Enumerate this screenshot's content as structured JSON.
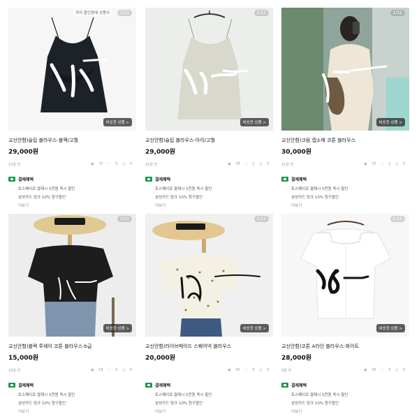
{
  "cards": [
    {
      "page": "1/12",
      "sponsor": "최저 할인판매 상품사",
      "similar": "비슷한 상품 >",
      "handwriting": "18,-",
      "title": "교신안함)슬립 블라우스-블랙/고퀄",
      "price": "29,000원",
      "ago": "15일 전",
      "stats": {
        "views": "72",
        "likes": "0",
        "chats": "0"
      }
    },
    {
      "page": "1/12",
      "similar": "비슷한 상품 >",
      "handwriting": "18,-",
      "title": "교신안함)슬립 블라우스-아이/고퀄",
      "price": "29,000원",
      "ago": "15일 전",
      "stats": {
        "views": "78",
        "likes": "1",
        "chats": "0"
      }
    },
    {
      "page": "1/12",
      "similar": "비슷한 상품 >",
      "handwriting": "19,-",
      "title": "교신안함)크림 캡소매 코튼 블라우스",
      "price": "30,000원",
      "ago": "21일 전",
      "stats": {
        "views": "75",
        "likes": "1",
        "chats": "0"
      }
    },
    {
      "page": "1/11",
      "similar": "비슷한 상품 >",
      "handwriting": "9,-",
      "title": "교신안함)블랙 투웨이 코튼 블라우스-b급",
      "price": "15,000원",
      "ago": "16일 전",
      "stats": {
        "views": "18",
        "likes": "0",
        "chats": "0"
      }
    },
    {
      "page": "1/12",
      "similar": "비슷한 상품 >",
      "handwriting": "10,-",
      "title": "교신안함)라이브메이드 스퀘어넥 블라우스",
      "price": "20,000원",
      "ago": "",
      "stats": {
        "views": "35",
        "likes": "0",
        "chats": "0"
      }
    },
    {
      "page": "1/12",
      "similar": "비슷한 상품 >",
      "handwriting": "18,-",
      "title": "교신안함)코튼 A라인 블라우스-화이트",
      "price": "28,000원",
      "ago": "9일 전",
      "stats": {
        "views": "43",
        "likes": "0",
        "chats": "0"
      }
    }
  ],
  "benefit": {
    "title": "결제혜택",
    "line1": "토스페이로 결제시 5천원 즉시 할인",
    "line2": "삼성카드 링크 10% 청구할인",
    "more": "더보기"
  },
  "colors": {
    "benefit_flag": "#1a9a4b",
    "price": "#111111"
  },
  "icons": [
    "chevron-right-icon",
    "eye-icon",
    "heart-icon",
    "chat-icon",
    "benefit-flag-icon"
  ]
}
